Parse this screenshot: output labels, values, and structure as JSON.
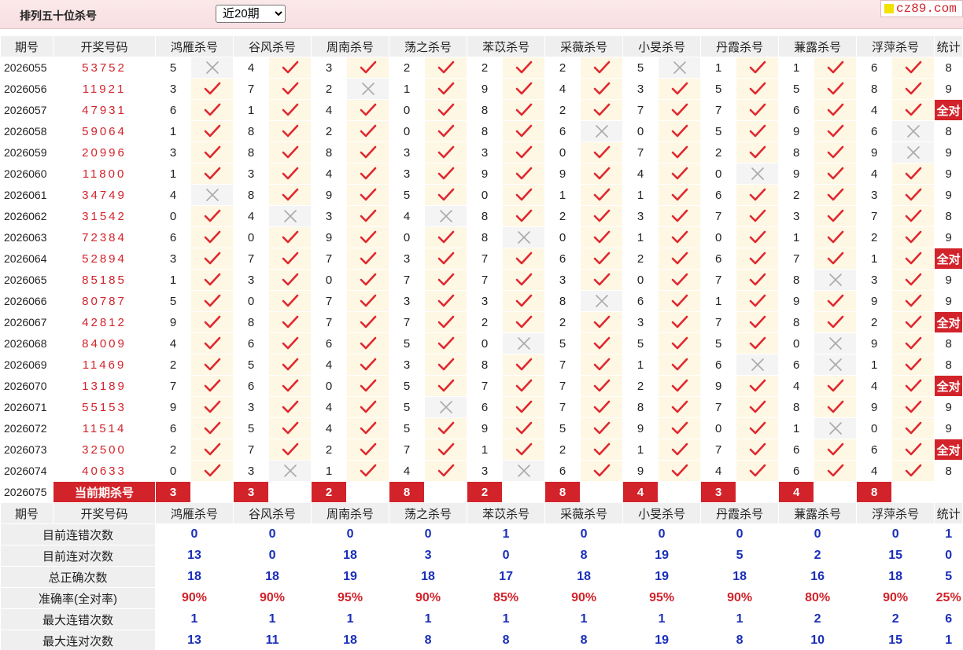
{
  "header": {
    "title": "排列五十位杀号",
    "period_select": {
      "selected": "近20期",
      "options": [
        "近20期"
      ]
    },
    "site": "cz89.com"
  },
  "columns": {
    "issue": "期号",
    "draw": "开奖号码",
    "experts": [
      "鸿雁杀号",
      "谷风杀号",
      "周南杀号",
      "荡之杀号",
      "苯苡杀号",
      "采薇杀号",
      "小旻杀号",
      "丹霞杀号",
      "蒹露杀号",
      "浮萍杀号"
    ],
    "stat": "统计"
  },
  "rows": [
    {
      "issue": "2026055",
      "draw": "53752",
      "kills": [
        [
          5,
          0
        ],
        [
          4,
          1
        ],
        [
          3,
          1
        ],
        [
          2,
          1
        ],
        [
          2,
          1
        ],
        [
          2,
          1
        ],
        [
          5,
          0
        ],
        [
          1,
          1
        ],
        [
          1,
          1
        ],
        [
          6,
          1
        ]
      ],
      "stat": "8"
    },
    {
      "issue": "2026056",
      "draw": "11921",
      "kills": [
        [
          3,
          1
        ],
        [
          7,
          1
        ],
        [
          2,
          0
        ],
        [
          1,
          1
        ],
        [
          9,
          1
        ],
        [
          4,
          1
        ],
        [
          3,
          1
        ],
        [
          5,
          1
        ],
        [
          5,
          1
        ],
        [
          8,
          1
        ]
      ],
      "stat": "9"
    },
    {
      "issue": "2026057",
      "draw": "47931",
      "kills": [
        [
          6,
          1
        ],
        [
          1,
          1
        ],
        [
          4,
          1
        ],
        [
          0,
          1
        ],
        [
          8,
          1
        ],
        [
          2,
          1
        ],
        [
          7,
          1
        ],
        [
          7,
          1
        ],
        [
          6,
          1
        ],
        [
          4,
          1
        ]
      ],
      "stat": "全对"
    },
    {
      "issue": "2026058",
      "draw": "59064",
      "kills": [
        [
          1,
          1
        ],
        [
          8,
          1
        ],
        [
          2,
          1
        ],
        [
          0,
          1
        ],
        [
          8,
          1
        ],
        [
          6,
          0
        ],
        [
          0,
          1
        ],
        [
          5,
          1
        ],
        [
          9,
          1
        ],
        [
          6,
          0
        ]
      ],
      "stat": "8"
    },
    {
      "issue": "2026059",
      "draw": "20996",
      "kills": [
        [
          3,
          1
        ],
        [
          8,
          1
        ],
        [
          8,
          1
        ],
        [
          3,
          1
        ],
        [
          3,
          1
        ],
        [
          0,
          1
        ],
        [
          7,
          1
        ],
        [
          2,
          1
        ],
        [
          8,
          1
        ],
        [
          9,
          0
        ]
      ],
      "stat": "9"
    },
    {
      "issue": "2026060",
      "draw": "11800",
      "kills": [
        [
          1,
          1
        ],
        [
          3,
          1
        ],
        [
          4,
          1
        ],
        [
          3,
          1
        ],
        [
          9,
          1
        ],
        [
          9,
          1
        ],
        [
          4,
          1
        ],
        [
          0,
          0
        ],
        [
          9,
          1
        ],
        [
          4,
          1
        ]
      ],
      "stat": "9"
    },
    {
      "issue": "2026061",
      "draw": "34749",
      "kills": [
        [
          4,
          0
        ],
        [
          8,
          1
        ],
        [
          9,
          1
        ],
        [
          5,
          1
        ],
        [
          0,
          1
        ],
        [
          1,
          1
        ],
        [
          1,
          1
        ],
        [
          6,
          1
        ],
        [
          2,
          1
        ],
        [
          3,
          1
        ]
      ],
      "stat": "9"
    },
    {
      "issue": "2026062",
      "draw": "31542",
      "kills": [
        [
          0,
          1
        ],
        [
          4,
          0
        ],
        [
          3,
          1
        ],
        [
          4,
          0
        ],
        [
          8,
          1
        ],
        [
          2,
          1
        ],
        [
          3,
          1
        ],
        [
          7,
          1
        ],
        [
          3,
          1
        ],
        [
          7,
          1
        ]
      ],
      "stat": "8"
    },
    {
      "issue": "2026063",
      "draw": "72384",
      "kills": [
        [
          6,
          1
        ],
        [
          0,
          1
        ],
        [
          9,
          1
        ],
        [
          0,
          1
        ],
        [
          8,
          0
        ],
        [
          0,
          1
        ],
        [
          1,
          1
        ],
        [
          0,
          1
        ],
        [
          1,
          1
        ],
        [
          2,
          1
        ]
      ],
      "stat": "9"
    },
    {
      "issue": "2026064",
      "draw": "52894",
      "kills": [
        [
          3,
          1
        ],
        [
          7,
          1
        ],
        [
          7,
          1
        ],
        [
          3,
          1
        ],
        [
          7,
          1
        ],
        [
          6,
          1
        ],
        [
          2,
          1
        ],
        [
          6,
          1
        ],
        [
          7,
          1
        ],
        [
          1,
          1
        ]
      ],
      "stat": "全对"
    },
    {
      "issue": "2026065",
      "draw": "85185",
      "kills": [
        [
          1,
          1
        ],
        [
          3,
          1
        ],
        [
          0,
          1
        ],
        [
          7,
          1
        ],
        [
          7,
          1
        ],
        [
          3,
          1
        ],
        [
          0,
          1
        ],
        [
          7,
          1
        ],
        [
          8,
          0
        ],
        [
          3,
          1
        ]
      ],
      "stat": "9"
    },
    {
      "issue": "2026066",
      "draw": "80787",
      "kills": [
        [
          5,
          1
        ],
        [
          0,
          1
        ],
        [
          7,
          1
        ],
        [
          3,
          1
        ],
        [
          3,
          1
        ],
        [
          8,
          0
        ],
        [
          6,
          1
        ],
        [
          1,
          1
        ],
        [
          9,
          1
        ],
        [
          9,
          1
        ]
      ],
      "stat": "9"
    },
    {
      "issue": "2026067",
      "draw": "42812",
      "kills": [
        [
          9,
          1
        ],
        [
          8,
          1
        ],
        [
          7,
          1
        ],
        [
          7,
          1
        ],
        [
          2,
          1
        ],
        [
          2,
          1
        ],
        [
          3,
          1
        ],
        [
          7,
          1
        ],
        [
          8,
          1
        ],
        [
          2,
          1
        ]
      ],
      "stat": "全对"
    },
    {
      "issue": "2026068",
      "draw": "84009",
      "kills": [
        [
          4,
          1
        ],
        [
          6,
          1
        ],
        [
          6,
          1
        ],
        [
          5,
          1
        ],
        [
          0,
          0
        ],
        [
          5,
          1
        ],
        [
          5,
          1
        ],
        [
          5,
          1
        ],
        [
          0,
          0
        ],
        [
          9,
          1
        ]
      ],
      "stat": "8"
    },
    {
      "issue": "2026069",
      "draw": "11469",
      "kills": [
        [
          2,
          1
        ],
        [
          5,
          1
        ],
        [
          4,
          1
        ],
        [
          3,
          1
        ],
        [
          8,
          1
        ],
        [
          7,
          1
        ],
        [
          1,
          1
        ],
        [
          6,
          0
        ],
        [
          6,
          0
        ],
        [
          1,
          1
        ]
      ],
      "stat": "8"
    },
    {
      "issue": "2026070",
      "draw": "13189",
      "kills": [
        [
          7,
          1
        ],
        [
          6,
          1
        ],
        [
          0,
          1
        ],
        [
          5,
          1
        ],
        [
          7,
          1
        ],
        [
          7,
          1
        ],
        [
          2,
          1
        ],
        [
          9,
          1
        ],
        [
          4,
          1
        ],
        [
          4,
          1
        ]
      ],
      "stat": "全对"
    },
    {
      "issue": "2026071",
      "draw": "55153",
      "kills": [
        [
          9,
          1
        ],
        [
          3,
          1
        ],
        [
          4,
          1
        ],
        [
          5,
          0
        ],
        [
          6,
          1
        ],
        [
          7,
          1
        ],
        [
          8,
          1
        ],
        [
          7,
          1
        ],
        [
          8,
          1
        ],
        [
          9,
          1
        ]
      ],
      "stat": "9"
    },
    {
      "issue": "2026072",
      "draw": "11514",
      "kills": [
        [
          6,
          1
        ],
        [
          5,
          1
        ],
        [
          4,
          1
        ],
        [
          5,
          1
        ],
        [
          9,
          1
        ],
        [
          5,
          1
        ],
        [
          9,
          1
        ],
        [
          0,
          1
        ],
        [
          1,
          0
        ],
        [
          0,
          1
        ]
      ],
      "stat": "9"
    },
    {
      "issue": "2026073",
      "draw": "32500",
      "kills": [
        [
          2,
          1
        ],
        [
          7,
          1
        ],
        [
          2,
          1
        ],
        [
          7,
          1
        ],
        [
          1,
          1
        ],
        [
          2,
          1
        ],
        [
          1,
          1
        ],
        [
          7,
          1
        ],
        [
          6,
          1
        ],
        [
          6,
          1
        ]
      ],
      "stat": "全对"
    },
    {
      "issue": "2026074",
      "draw": "40633",
      "kills": [
        [
          0,
          1
        ],
        [
          3,
          0
        ],
        [
          1,
          1
        ],
        [
          4,
          1
        ],
        [
          3,
          0
        ],
        [
          6,
          1
        ],
        [
          9,
          1
        ],
        [
          4,
          1
        ],
        [
          6,
          1
        ],
        [
          4,
          1
        ]
      ],
      "stat": "8"
    }
  ],
  "current": {
    "issue": "2026075",
    "label": "当前期杀号",
    "kills": [
      "3",
      "3",
      "2",
      "8",
      "2",
      "8",
      "4",
      "3",
      "4",
      "8"
    ]
  },
  "summary": [
    {
      "label": "目前连错次数",
      "values": [
        "0",
        "0",
        "0",
        "0",
        "1",
        "0",
        "0",
        "0",
        "0",
        "0",
        "1"
      ]
    },
    {
      "label": "目前连对次数",
      "values": [
        "13",
        "0",
        "18",
        "3",
        "0",
        "8",
        "19",
        "5",
        "2",
        "15",
        "0"
      ]
    },
    {
      "label": "总正确次数",
      "values": [
        "18",
        "18",
        "19",
        "18",
        "17",
        "18",
        "19",
        "18",
        "16",
        "18",
        "5"
      ]
    },
    {
      "label": "准确率(全对率)",
      "values": [
        "90%",
        "90%",
        "95%",
        "90%",
        "85%",
        "90%",
        "95%",
        "90%",
        "80%",
        "90%",
        "25%"
      ],
      "red": true
    },
    {
      "label": "最大连错次数",
      "values": [
        "1",
        "1",
        "1",
        "1",
        "1",
        "1",
        "1",
        "1",
        "2",
        "2",
        "6"
      ]
    },
    {
      "label": "最大连对次数",
      "values": [
        "13",
        "11",
        "18",
        "8",
        "8",
        "8",
        "19",
        "8",
        "10",
        "15",
        "1"
      ]
    }
  ],
  "colors": {
    "red": "#d2232a",
    "blue": "#1a2fb8",
    "check": "#e0282e",
    "cross": "#aaaaaa"
  }
}
